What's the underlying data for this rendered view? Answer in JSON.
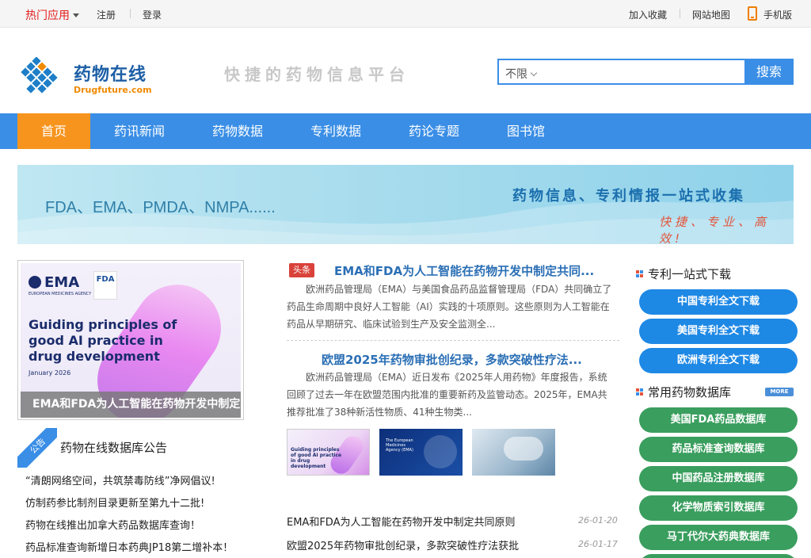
{
  "topbar": {
    "hot_apps": "热门应用",
    "register": "注册",
    "login": "登录",
    "bookmark": "加入收藏",
    "sitemap": "网站地图",
    "mobile": "手机版"
  },
  "header": {
    "logo_cn": "药物在线",
    "logo_en": "Drugfuture.com",
    "slogan": "快捷的药物信息平台",
    "search_scope": "不限",
    "search_placeholder": "",
    "search_button": "搜索"
  },
  "nav": {
    "items": [
      "首页",
      "药讯新闻",
      "药物数据",
      "专利数据",
      "药论专题",
      "图书馆"
    ],
    "active": "首页"
  },
  "banner": {
    "left_text": "FDA、EMA、PMDA、NMPA......",
    "right_line1": "药物信息、专利情报一站式收集",
    "right_line2": "快捷、专业、高效!"
  },
  "feature": {
    "ema": "EMA",
    "ema_sub": "EUROPEAN MEDICINES AGENCY",
    "fda": "FDA",
    "headline": "Guiding principles of good AI practice in drug development",
    "date": "January 2026",
    "caption": "EMA和FDA为人工智能在药物开发中制定"
  },
  "notice": {
    "ribbon": "公告",
    "title": "药物在线数据库公告",
    "items": [
      "“清朗网络空间，共筑禁毒防线”净网倡议!",
      "仿制药参比制剂目录更新至第九十二批!",
      "药物在线推出加拿大药品数据库查询！",
      "药品标准查询新增日本药典JP18第二增补本！"
    ]
  },
  "news": {
    "tag": "头条",
    "items": [
      {
        "title": "EMA和FDA为人工智能在药物开发中制定共同...",
        "body": "欧洲药品管理局（EMA）与美国食品药品监督管理局（FDA）共同确立了药品生命周期中良好人工智能（AI）实践的十项原则。这些原则为人工智能在药品从早期研究、临床试验到生产及安全监测全..."
      },
      {
        "title": "欧盟2025年药物审批创纪录，多款突破性疗法...",
        "body": "欧洲药品管理局（EMA）近日发布《2025年人用药物》年度报告，系统回顾了过去一年在欧盟范围内批准的重要新药及监管动态。2025年，EMA共推荐批准了38种新活性物质、41种生物类..."
      }
    ],
    "thumbs": [
      {
        "title": "Guiding principles of good AI practice in drug development"
      },
      {
        "title": "The European Medicines Agency (EMA)"
      },
      {
        "title": ""
      }
    ],
    "list": [
      {
        "title": "EMA和FDA为人工智能在药物开发中制定共同原则",
        "date": "26-01-20"
      },
      {
        "title": "欧盟2025年药物审批创纪录，多款突破性疗法获批",
        "date": "26-01-17"
      }
    ]
  },
  "sidebar": {
    "patent_title": "专利一站式下载",
    "patent_buttons": [
      "中国专利全文下载",
      "美国专利全文下载",
      "欧洲专利全文下载"
    ],
    "db_title": "常用药物数据库",
    "more": "MORE",
    "db_buttons": [
      "美国FDA药品数据库",
      "药品标准查询数据库",
      "中国药品注册数据库",
      "化学物质索引数据库",
      "马丁代尔大药典数据库"
    ]
  },
  "colors": {
    "primary_blue": "#3a8ee6",
    "nav_active_orange": "#f7941d",
    "hot_red": "#e21e1e",
    "green_button": "#3a9e5e",
    "blue_button": "#1e88e5"
  }
}
